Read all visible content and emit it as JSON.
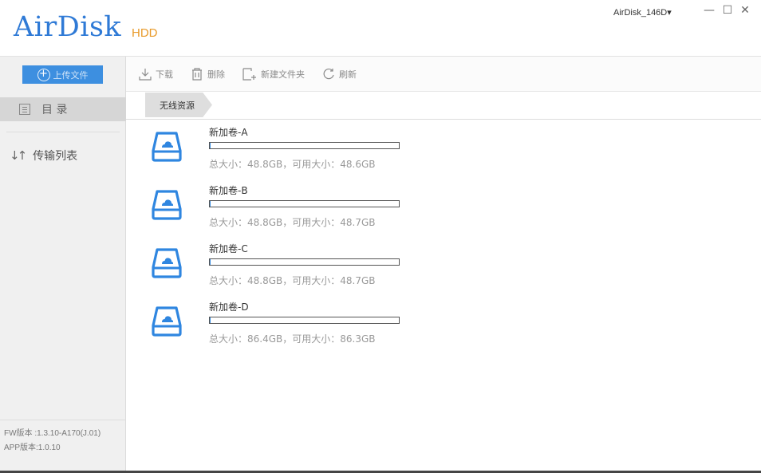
{
  "app": {
    "logo": "AirDisk",
    "logo_sub": "HDD",
    "device": "AirDisk_146D▾",
    "window_controls": {
      "minimize": "—",
      "maximize": "☐",
      "close": "✕"
    }
  },
  "sidebar": {
    "upload_label": "上传文件",
    "directory_label": "目 录",
    "transfer_label": "传输列表",
    "fw_version": "FW版本 :1.3.10-A170(J.01)",
    "app_version": "APP版本:1.0.10"
  },
  "toolbar": {
    "download": "下载",
    "delete": "删除",
    "new_folder": "新建文件夹",
    "refresh": "刷新"
  },
  "breadcrumb": {
    "current": "无线资源"
  },
  "volumes": [
    {
      "name": "新加卷-A",
      "info": "总大小：48.8GB，可用大小：48.6GB",
      "used_fraction": 0.004
    },
    {
      "name": "新加卷-B",
      "info": "总大小：48.8GB，可用大小：48.7GB",
      "used_fraction": 0.002
    },
    {
      "name": "新加卷-C",
      "info": "总大小：48.8GB，可用大小：48.7GB",
      "used_fraction": 0.002
    },
    {
      "name": "新加卷-D",
      "info": "总大小：86.4GB，可用大小：86.3GB",
      "used_fraction": 0.001
    }
  ],
  "colors": {
    "accent": "#3d8fe0",
    "logo": "#2f7ad6",
    "logo_sub": "#e89a2a"
  },
  "icons": {
    "upload": "plus-circle-icon",
    "directory": "list-icon",
    "transfer": "sort-arrows-icon",
    "download": "download-icon",
    "delete": "trash-icon",
    "new_folder": "new-folder-icon",
    "refresh": "refresh-icon",
    "volume": "cloud-drive-icon"
  }
}
